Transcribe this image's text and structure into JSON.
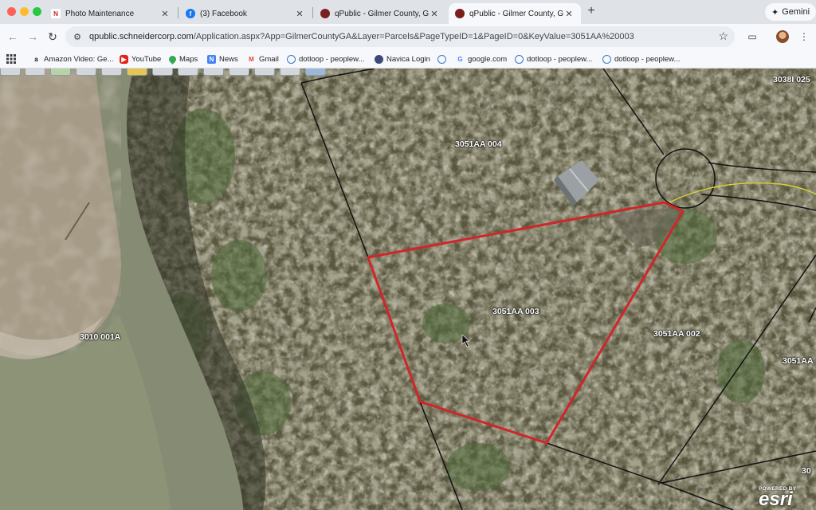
{
  "browser": {
    "tabs": [
      {
        "title": "Photo Maintenance",
        "favicon": "n-logo-icon"
      },
      {
        "title": "(3) Facebook",
        "favicon": "facebook-icon"
      },
      {
        "title": "qPublic - Gilmer County, GA",
        "favicon": "qpublic-icon"
      },
      {
        "title": "qPublic - Gilmer County, GA",
        "favicon": "qpublic-icon",
        "active": true
      }
    ],
    "new_tab": "+",
    "gemini_label": "Gemini",
    "url_host": "qpublic.schneidercorp.com",
    "url_path": "/Application.aspx?App=GilmerCountyGA&Layer=Parcels&PageTypeID=1&PageID=0&KeyValue=3051AA%20003"
  },
  "bookmarks": [
    {
      "label": "Amazon Video: Ge...",
      "icon": "amazon-icon"
    },
    {
      "label": "YouTube",
      "icon": "youtube-icon"
    },
    {
      "label": "Maps",
      "icon": "maps-icon"
    },
    {
      "label": "News",
      "icon": "news-icon"
    },
    {
      "label": "Gmail",
      "icon": "gmail-icon"
    },
    {
      "label": "dotloop - peoplew...",
      "icon": "dotloop-icon"
    },
    {
      "label": "Navica Login",
      "icon": "navica-icon"
    },
    {
      "label": "",
      "icon": "dotloop-icon"
    },
    {
      "label": "google.com",
      "icon": "google-icon"
    },
    {
      "label": "dotloop - peoplew...",
      "icon": "dotloop-icon"
    },
    {
      "label": "dotloop - peoplew...",
      "icon": "dotloop-icon"
    }
  ],
  "map": {
    "parcels": [
      {
        "id": "3051AA 004"
      },
      {
        "id": "3051AA 003",
        "selected": true
      },
      {
        "id": "3051AA 002"
      },
      {
        "id": "3051AA"
      },
      {
        "id": "3010 001A"
      },
      {
        "id": "3038I 025"
      },
      {
        "id": "30"
      }
    ],
    "selected_color": "#d0262a",
    "boundary_color": "#111111",
    "road_color": "#d9d23a",
    "attribution_top": "POWERED BY",
    "attribution_logo": "esri"
  }
}
